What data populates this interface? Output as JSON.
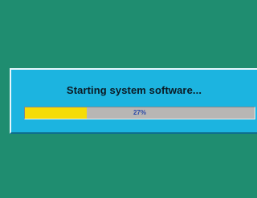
{
  "screen": {
    "background_color": "#1f8d70"
  },
  "dialog": {
    "title": "Starting system software...",
    "background_color": "#1cb4e0"
  },
  "progress": {
    "value": 0.27,
    "label": "27%",
    "fill_color": "#f5dc07",
    "track_color": "#b8b6b4"
  }
}
